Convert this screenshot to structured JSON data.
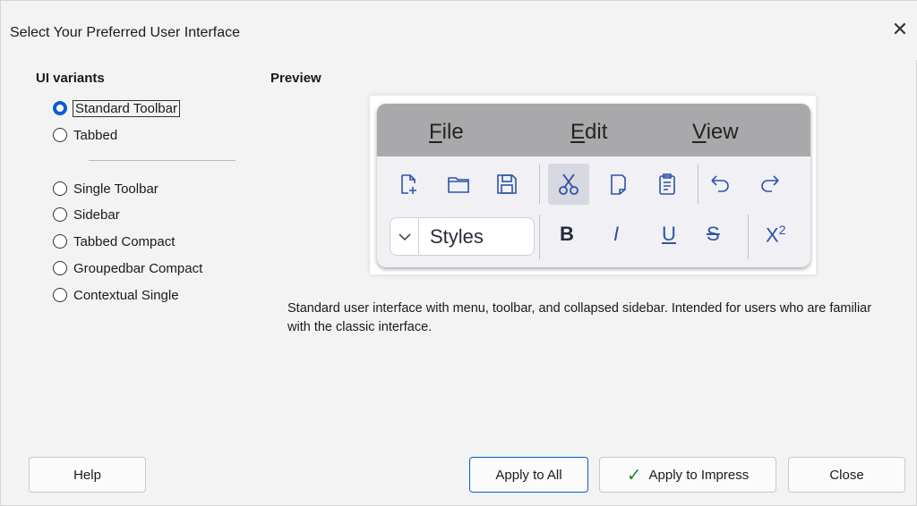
{
  "window": {
    "title": "Select Your Preferred User Interface",
    "close_glyph": "✕"
  },
  "variants": {
    "label": "UI variants",
    "options": [
      {
        "label": "Standard Toolbar",
        "checked": true
      },
      {
        "label": "Tabbed",
        "checked": false
      },
      {
        "label": "Single Toolbar",
        "checked": false
      },
      {
        "label": "Sidebar",
        "checked": false
      },
      {
        "label": "Tabbed Compact",
        "checked": false
      },
      {
        "label": "Groupedbar Compact",
        "checked": false
      },
      {
        "label": "Contextual Single",
        "checked": false
      }
    ]
  },
  "preview": {
    "label": "Preview",
    "menus": [
      {
        "accel": "F",
        "rest": "ile"
      },
      {
        "accel": "E",
        "rest": "dit"
      },
      {
        "accel": "V",
        "rest": "iew"
      }
    ],
    "styles_text": "Styles",
    "format": {
      "bold": "B",
      "italic": "I",
      "underline": "U",
      "strike": "S",
      "superscript_base": "X",
      "superscript_exp": "2"
    },
    "icons": [
      "new-document-icon",
      "open-folder-icon",
      "save-icon",
      "cut-icon",
      "copy-icon",
      "paste-icon",
      "undo-icon",
      "redo-icon",
      "chevron-down-icon"
    ],
    "accent_color": "#2f53a8"
  },
  "description": "Standard user interface with menu, toolbar, and collapsed sidebar. Intended for users who are familiar with the classic interface.",
  "buttons": {
    "help": "Help",
    "apply_all": "Apply to All",
    "apply_impress": "Apply to Impress",
    "close": "Close"
  },
  "colors": {
    "radio_checked": "#0a5ecb",
    "default_button_border": "#0a5ecb",
    "check_mark": "#1e8a2e"
  }
}
